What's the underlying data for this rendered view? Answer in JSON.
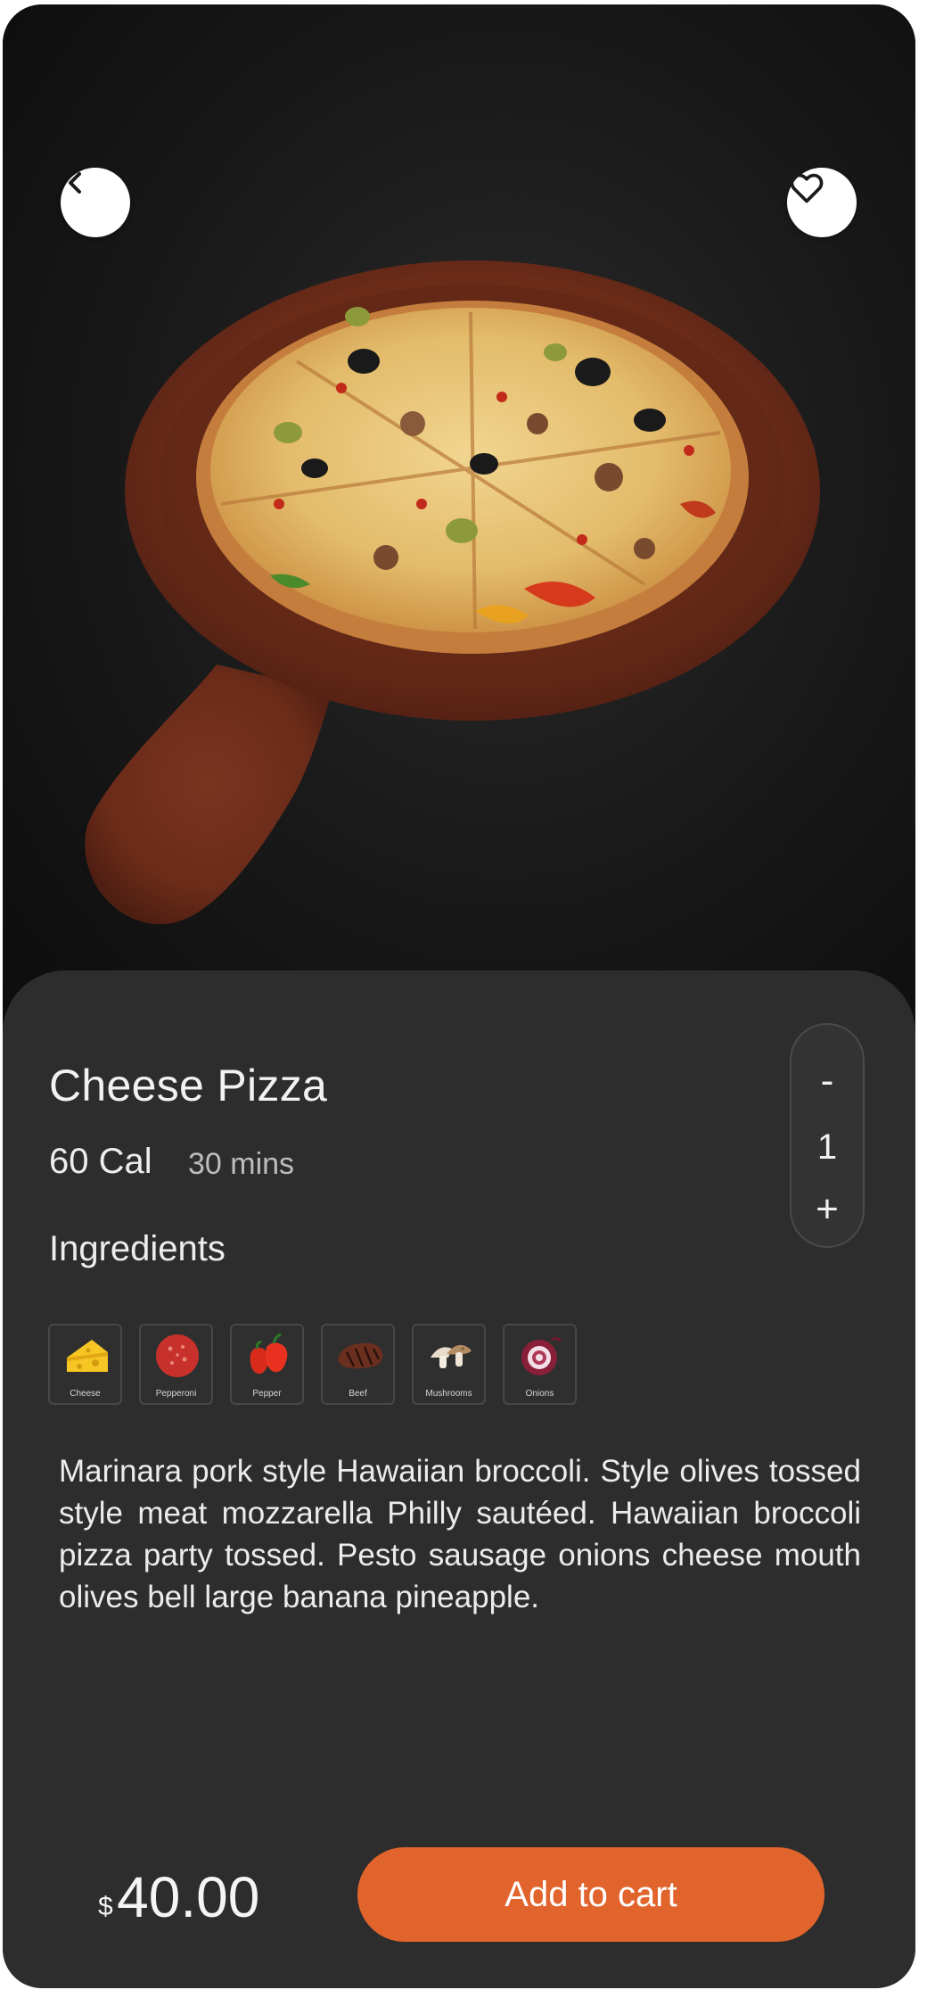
{
  "product": {
    "name": "Cheese Pizza",
    "calories": "60 Cal",
    "time": "30 mins",
    "ingredients_heading": "Ingredients",
    "description": "Marinara pork style Hawaiian broccoli. Style olives tossed style meat mozzarella Philly sautéed. Hawaiian broccoli pizza party tossed. Pesto sausage onions cheese mouth olives bell large banana pineapple.",
    "image_icon": "pizza-on-wooden-board"
  },
  "quantity": {
    "minus_label": "-",
    "value": "1",
    "plus_label": "+"
  },
  "ingredients": [
    {
      "label": "Cheese",
      "icon": "cheese-icon"
    },
    {
      "label": "Pepperoni",
      "icon": "pepperoni-icon"
    },
    {
      "label": "Pepper",
      "icon": "pepper-icon"
    },
    {
      "label": "Beef",
      "icon": "beef-icon"
    },
    {
      "label": "Mushrooms",
      "icon": "mushrooms-icon"
    },
    {
      "label": "Onions",
      "icon": "onions-icon"
    }
  ],
  "price": {
    "currency": "$",
    "amount": "40.00"
  },
  "actions": {
    "back_icon": "chevron-left-icon",
    "favorite_icon": "heart-icon",
    "add_to_cart_label": "Add to cart"
  },
  "colors": {
    "accent": "#e2642d",
    "panel": "#2d2d2d",
    "text": "#f2f2f2"
  }
}
